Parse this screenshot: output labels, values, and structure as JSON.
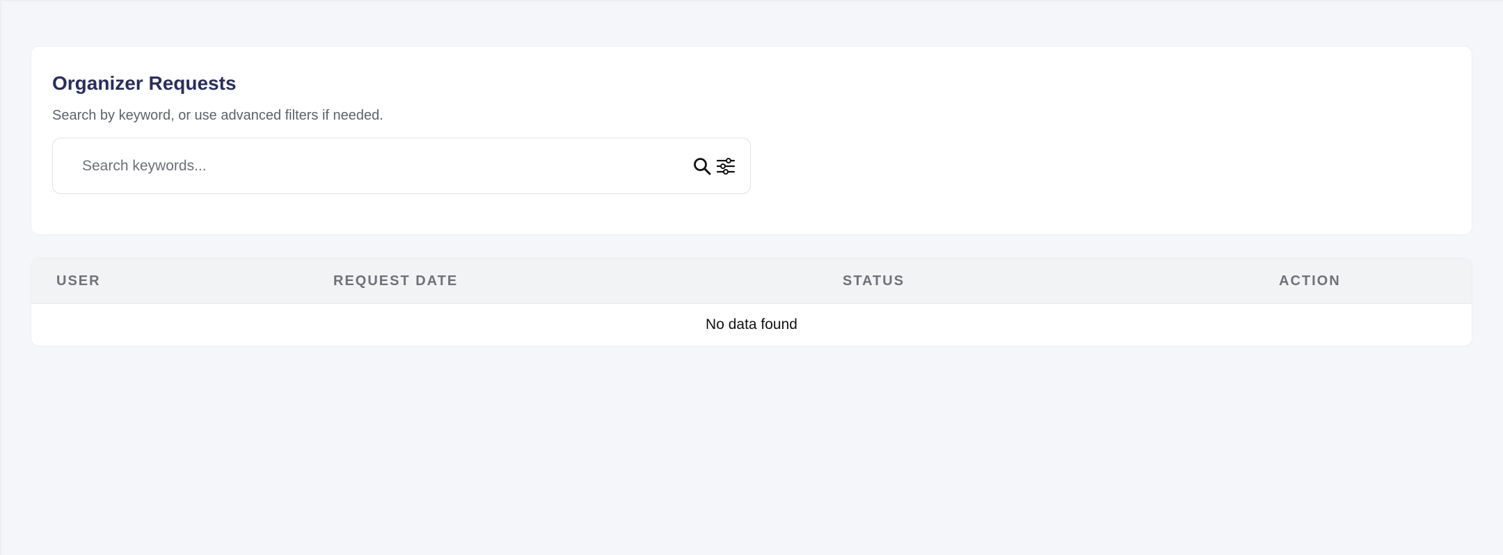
{
  "header": {
    "title": "Organizer Requests",
    "subtitle": "Search by keyword, or use advanced filters if needed."
  },
  "search": {
    "placeholder": "Search keywords...",
    "value": "",
    "search_icon": "search-icon",
    "filter_icon": "sliders-icon"
  },
  "table": {
    "columns": [
      "USER",
      "REQUEST DATE",
      "STATUS",
      "ACTION"
    ],
    "rows": [],
    "empty_message": "No data found"
  },
  "colors": {
    "title": "#2b2d5c",
    "background": "#f5f6fa",
    "header_row": "#f2f3f5"
  }
}
